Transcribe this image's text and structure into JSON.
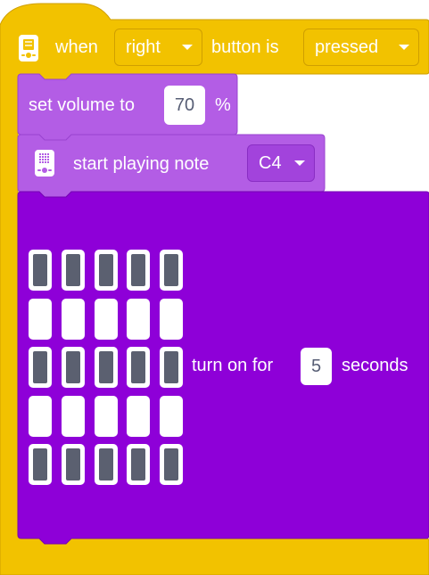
{
  "hat_block": {
    "when_label": "when",
    "button_dropdown": "right",
    "button_is_label": "button is",
    "state_dropdown": "pressed",
    "icon": "hub-button-icon"
  },
  "volume_block": {
    "label": "set volume to",
    "value": "70",
    "unit": "%"
  },
  "note_block": {
    "icon": "hub-light-matrix-icon",
    "label": "start playing note",
    "note_dropdown": "C4"
  },
  "matrix_block": {
    "label": "turn on for",
    "duration_value": "5",
    "unit_label": "seconds",
    "pixel_grid": [
      [
        1,
        1,
        1,
        1,
        1
      ],
      [
        0,
        0,
        0,
        0,
        0
      ],
      [
        1,
        1,
        1,
        1,
        1
      ],
      [
        0,
        0,
        0,
        0,
        0
      ],
      [
        1,
        1,
        1,
        1,
        1
      ]
    ]
  },
  "colors": {
    "events_yellow": "#f2c200",
    "events_border": "#cf9f00",
    "sound_purple": "#b35de5",
    "matrix_purple": "#8e00d8",
    "pixel_on": "#5b6070",
    "pixel_off": "#ffffff"
  }
}
